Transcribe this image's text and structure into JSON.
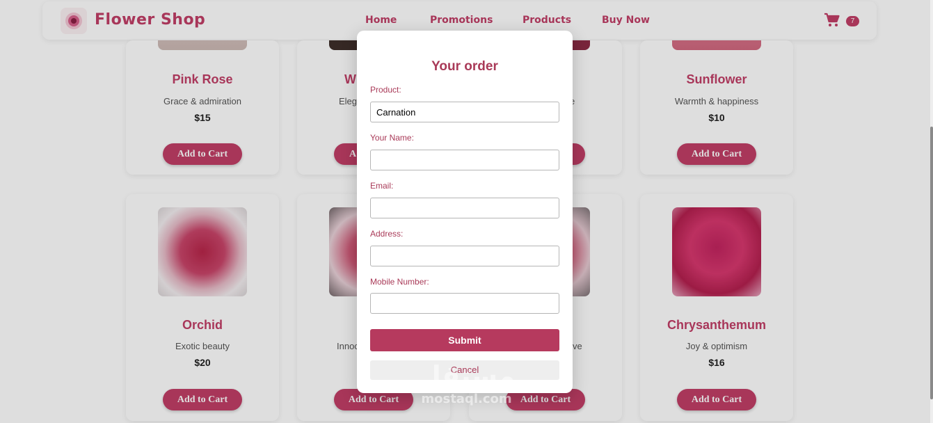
{
  "header": {
    "brand": "Flower Shop",
    "nav": [
      "Home",
      "Promotions",
      "Products",
      "Buy Now"
    ],
    "cart_count": "7"
  },
  "products_row1": [
    {
      "name": "Pink Rose",
      "desc": "Grace & admiration",
      "price": "$15",
      "button": "Add to Cart"
    },
    {
      "name": "W",
      "desc": "Eleg",
      "price": "",
      "button": "A"
    },
    {
      "name": "",
      "desc": "e",
      "price": "",
      "button": ""
    },
    {
      "name": "Sunflower",
      "desc": "Warmth & happiness",
      "price": "$10",
      "button": "Add to Cart"
    }
  ],
  "products_row2": [
    {
      "name": "Orchid",
      "desc": "Exotic beauty",
      "price": "$20",
      "button": "Add to Cart"
    },
    {
      "name": "",
      "desc": "Innoc",
      "price": "",
      "button": "Add to Cart"
    },
    {
      "name": "",
      "desc": "ve",
      "price": "",
      "button": "Add to Cart"
    },
    {
      "name": "Chrysanthemum",
      "desc": "Joy & optimism",
      "price": "$16",
      "button": "Add to Cart"
    }
  ],
  "modal": {
    "title": "Your order",
    "product_label": "Product:",
    "product_value": "Carnation",
    "name_label": "Your Name:",
    "name_value": "",
    "email_label": "Email:",
    "email_value": "",
    "address_label": "Address:",
    "address_value": "",
    "mobile_label": "Mobile Number:",
    "mobile_value": "",
    "submit": "Submit",
    "cancel": "Cancel"
  },
  "watermark": {
    "arabic": "مستقل",
    "latin": "mostaql.com"
  },
  "colors": {
    "accent": "#c23e67",
    "modal_text": "#a93a58",
    "submit": "#b63a5e"
  }
}
